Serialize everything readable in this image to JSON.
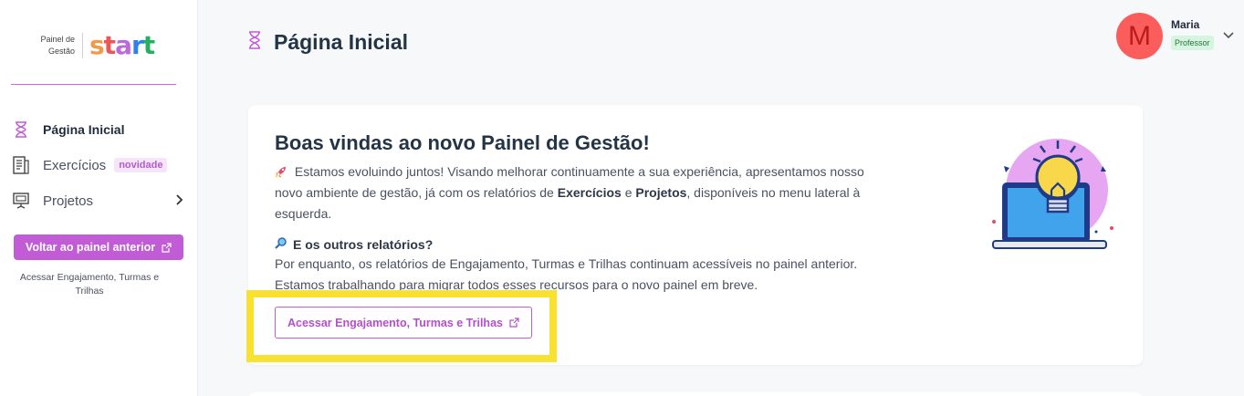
{
  "sidebar": {
    "logo": {
      "small_text": "Painel de Gestão",
      "word": [
        "s",
        "t",
        "a",
        "r",
        "t"
      ]
    },
    "items": [
      {
        "label": "Página Inicial",
        "icon": "hourglass-icon",
        "active": true
      },
      {
        "label": "Exercícios",
        "icon": "document-icon",
        "badge": "novidade"
      },
      {
        "label": "Projetos",
        "icon": "projector-icon",
        "has_submenu": true
      }
    ],
    "back_button": "Voltar ao painel anterior",
    "note": "Acessar Engajamento, Turmas e Trilhas"
  },
  "header": {
    "title": "Página Inicial",
    "title_icon": "hourglass-icon"
  },
  "user": {
    "initial": "M",
    "name": "Maria",
    "role": "Professor"
  },
  "welcome": {
    "title": "Boas vindas ao novo Painel de Gestão!",
    "p1_a": "Estamos evoluindo juntos! Visando melhorar continuamente a sua experiência, apresentamos nosso novo ambiente de gestão, já com os relatórios de ",
    "p1_b": "Exercícios",
    "p1_c": " e ",
    "p1_d": "Projetos",
    "p1_e": ", disponíveis no menu lateral à esquerda.",
    "subtitle": "E os outros relatórios?",
    "p2": "Por enquanto, os relatórios de Engajamento, Turmas e Trilhas continuam acessíveis no painel anterior. Estamos trabalhando para migrar todos esses recursos para o novo painel em breve.",
    "button": "Acessar Engajamento, Turmas e Trilhas"
  },
  "colors": {
    "accent": "#c15cd6",
    "highlight": "#f8e132",
    "avatar": "#fb5d5d",
    "role_badge": "#d6f5df"
  }
}
